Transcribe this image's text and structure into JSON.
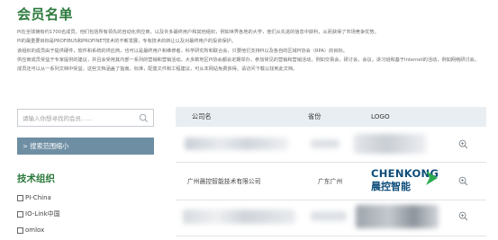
{
  "page_title": "会员名单",
  "intro": [
    "PI在全球拥有约1700名成员。他们包括所有领先的自动化供应商，以及许多最终用户和其他组织，例如世界各地的大学，他们从先进的信息中获利，从而获得了市场竞争优势。",
    "PI的最重要目标是PROFIBUS和PROFINET技术的不断发展，专有技术的转让以及对最终用户的投资保护。",
    "该组织的成员由于提供硬件，软件和系统的供应商，也可以是最终用户和维修者，科学研究所和联合会，只要他们支持PI以及各自的区域PI协会（RPA）的目标。",
    "供应商成员受益于专家提供的建议，并且会受用其内部一系列的营销和营销活动。大多数地区PI协会都会定期举办，参加常见的营销和营销活动，例如交易会，研讨会，会议，讲习班和基于Internet的活动，例如网络研讨会。",
    "成员还可以从一系列文档中受益，这些文档涵盖了指南，标准，配置文件和工程建议，可从本网站免费获得。请访问下载以找到此文档。"
  ],
  "search": {
    "placeholder": "请输入你想寻找的会员......"
  },
  "scope_button": "> 搜索范围缩小",
  "tech_group": {
    "title": "技术组织",
    "items": [
      "PI-China",
      "IO-Link中国",
      "omlox"
    ]
  },
  "table": {
    "headers": {
      "company": "公司名",
      "province": "省份",
      "logo": "LOGO"
    },
    "rows": [
      {
        "company": "",
        "province": "",
        "blurred": true
      },
      {
        "company": "广州晨控智能技术有限公司",
        "province": "广东广州",
        "logo_en": "CHENKONG",
        "logo_cn": "晨控智能",
        "blurred": false
      },
      {
        "company": "",
        "province": "",
        "blurred": true
      }
    ]
  },
  "colors": {
    "accent": "#2c7a3d",
    "button": "#6e8ea3",
    "header_bg": "#e9eef2",
    "logo_blue": "#0f4d7a",
    "logo_green": "#2daa4f"
  },
  "icons": {
    "search": "search-icon",
    "zoom": "zoom-in-icon"
  }
}
